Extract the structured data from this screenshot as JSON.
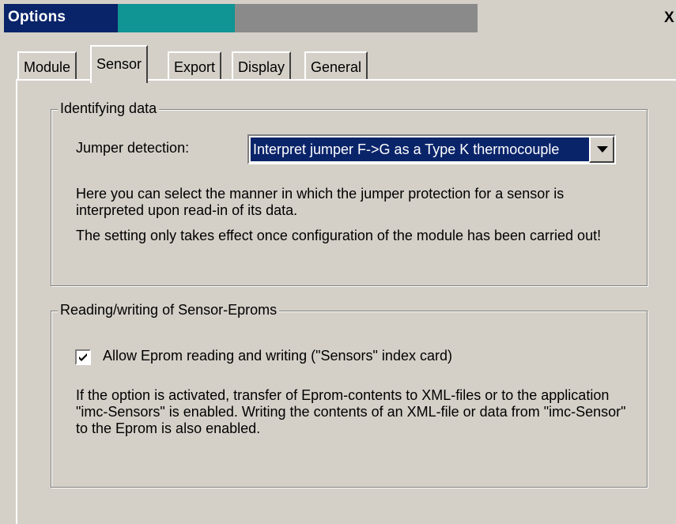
{
  "window": {
    "title": "Options",
    "close_glyph": "X"
  },
  "tabs": [
    {
      "label": "Module",
      "active": false
    },
    {
      "label": "Sensor",
      "active": true
    },
    {
      "label": "Export",
      "active": false
    },
    {
      "label": "Display",
      "active": false
    },
    {
      "label": "General",
      "active": false
    }
  ],
  "identifying": {
    "legend": "Identifying data",
    "jumper_label": "Jumper detection:",
    "jumper_value": "Interpret jumper F->G as a Type K thermocouple",
    "description_1": "Here you can select the manner in which the jumper protection for a sensor is interpreted upon read-in of its data.",
    "description_2": "The setting only takes effect once configuration of the module has been carried out!"
  },
  "eprom": {
    "legend": "Reading/writing of Sensor-Eproms",
    "checkbox_label": "Allow Eprom reading and writing (\"Sensors\" index card)",
    "checkbox_checked": true,
    "description": "If the option is activated, transfer of Eprom-contents to XML-files or to the application \"imc-Sensors\" is enabled. Writing the contents of an XML-file or data from \"imc-Sensor\" to the Eprom is also enabled."
  },
  "icons": {
    "dropdown": "chevron-down-icon",
    "check": "checkmark-icon",
    "close": "close-icon"
  },
  "colors": {
    "title_active": "#0a246a",
    "title_gradient_mid": "#119494",
    "title_inactive": "#8a8a8a",
    "face": "#d4d0c8",
    "selection": "#0a246a"
  }
}
